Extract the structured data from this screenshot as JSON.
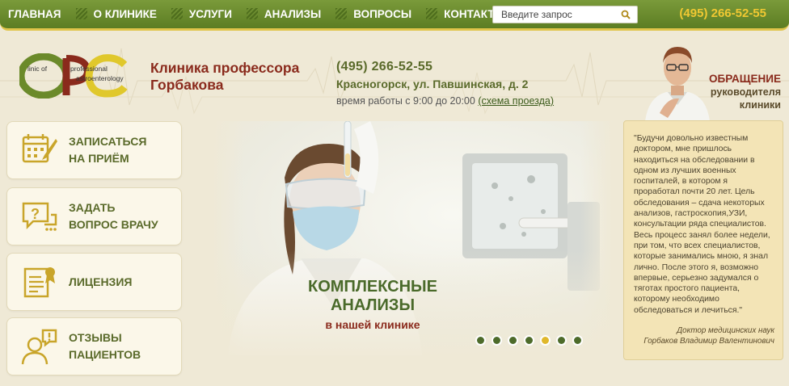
{
  "nav": {
    "items": [
      "ГЛАВНАЯ",
      "О КЛИНИКЕ",
      "УСЛУГИ",
      "АНАЛИЗЫ",
      "ВОПРОСЫ",
      "КОНТАКТЫ"
    ],
    "search_placeholder": "Введите запрос",
    "phone": "(495) 266-52-55"
  },
  "header": {
    "logo_text": [
      "linic of",
      "professional",
      "astroenterology"
    ],
    "clinic_name_line1": "Клиника профессора",
    "clinic_name_line2": "Горбакова",
    "phone": "(495) 266-52-55",
    "address": "Красногорск, ул. Павшинская, д. 2",
    "hours": "время работы с 9:00 до 20:00",
    "route_link": "(схема проезда)"
  },
  "director": {
    "title1": "ОБРАЩЕНИЕ",
    "title2": "руководителя",
    "title3": "клиники"
  },
  "side": [
    {
      "line1": "ЗАПИСАТЬСЯ",
      "line2": "НА ПРИЁМ",
      "icon": "calendar-pen-icon"
    },
    {
      "line1": "ЗАДАТЬ",
      "line2": "ВОПРОС ВРАЧУ",
      "icon": "question-chat-icon"
    },
    {
      "line1": "ЛИЦЕНЗИЯ",
      "line2": "",
      "icon": "certificate-icon"
    },
    {
      "line1": "ОТЗЫВЫ",
      "line2": "ПАЦИЕНТОВ",
      "icon": "patient-feedback-icon"
    }
  ],
  "banner": {
    "line1": "КОМПЛЕКСНЫЕ",
    "line2": "АНАЛИЗЫ",
    "line3": "в нашей клинике",
    "slides": 7,
    "active_slide": 5
  },
  "quote": {
    "text": "\"Будучи довольно известным доктором, мне пришлось находиться на обследовании в одном из лучших военных госпиталей, в котором я проработал почти 20 лет. Цель обследования – сдача некоторых анализов, гастроскопия,УЗИ, консультации ряда специалистов. Весь процесс занял более недели, при том, что всех специалистов, которые занимались мною, я знал лично. После этого я, возможно впервые, серьезно задумался о тяготах простого пациента, которому необходимо обследоваться и лечиться.\"",
    "sig1": "Доктор медицинских наук",
    "sig2": "Горбаков Владимир Валентинович"
  },
  "colors": {
    "nav_green": "#5c7d23",
    "accent_yellow": "#e0b82c",
    "brand_red": "#8a2a1c",
    "text_green": "#5a6a2a",
    "background": "#efe9d6"
  }
}
